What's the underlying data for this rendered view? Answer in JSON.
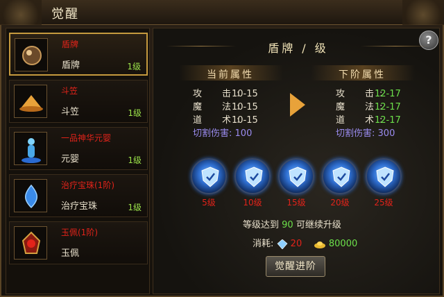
{
  "window": {
    "title": "觉醒"
  },
  "equipment_list": [
    {
      "name": "盾牌",
      "sub": "盾牌",
      "level": "1级",
      "icon": "shield-orb-icon",
      "selected": true
    },
    {
      "name": "斗笠",
      "sub": "斗笠",
      "level": "1级",
      "icon": "straw-hat-icon"
    },
    {
      "name": "一品神华元婴",
      "sub": "元婴",
      "level": "1级",
      "icon": "spirit-figure-icon"
    },
    {
      "name": "治疗宝珠(1阶)",
      "sub": "治疗宝珠",
      "level": "1级",
      "icon": "blue-gem-icon"
    },
    {
      "name": "玉佩(1阶)",
      "sub": "玉佩",
      "level": "",
      "icon": "red-jade-icon"
    }
  ],
  "detail": {
    "header": "盾牌 / 级",
    "current": {
      "title": "当前属性",
      "stats": [
        {
          "label": "攻　击:",
          "value": "10-15"
        },
        {
          "label": "魔　法:",
          "value": "10-15"
        },
        {
          "label": "道　术:",
          "value": "10-15"
        }
      ],
      "cut_label": "切割伤害:",
      "cut_value": "100"
    },
    "next": {
      "title": "下阶属性",
      "stats": [
        {
          "label": "攻　击:",
          "value": "12-17"
        },
        {
          "label": "魔　法:",
          "value": "12-17"
        },
        {
          "label": "道　术:",
          "value": "12-17"
        }
      ],
      "cut_label": "切割伤害:",
      "cut_value": "300"
    },
    "milestones": [
      "5级",
      "10级",
      "15级",
      "20级",
      "25级"
    ],
    "requirement": {
      "prefix": "等级达到",
      "level": "90",
      "suffix": "可继续升级"
    },
    "cost": {
      "label": "消耗:",
      "crystal": "20",
      "gold": "80000"
    },
    "button_label": "觉醒进阶"
  },
  "colors": {
    "accent_gold": "#c69a3e",
    "name_red": "#e2231a",
    "level_green": "#9be24a",
    "cut_purple": "#9b8cf0"
  }
}
